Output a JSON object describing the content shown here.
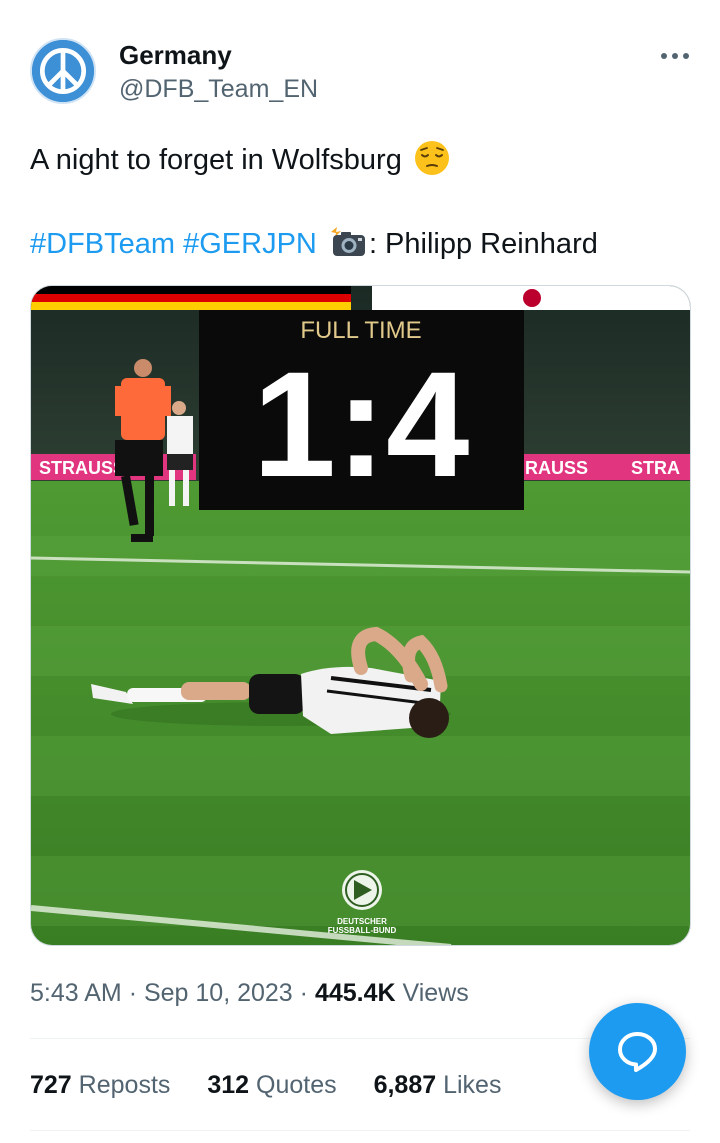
{
  "account": {
    "display_name": "Germany",
    "handle": "@DFB_Team_EN",
    "avatar_icon": "peace-sign-icon"
  },
  "tweet": {
    "text": "A night to forget in Wolfsburg",
    "text_emoji": "pensive-face-emoji",
    "hashtags": [
      "#DFBTeam",
      "#GERJPN"
    ],
    "camera_emoji": "camera-with-flash-emoji",
    "photo_credit": ": Philipp Reinhard"
  },
  "media": {
    "label": "FULL TIME",
    "score": "1:4",
    "banner_text_left": "STRAUSS",
    "banner_text_right": "RAUSS",
    "banner_text_right2": "STRA",
    "logo_text_line1": "DEUTSCHER",
    "logo_text_line2": "FUSSBALL-BUND"
  },
  "meta": {
    "time": "5:43 AM",
    "separator": "·",
    "date": "Sep 10, 2023",
    "views_count": "445.4K",
    "views_label": "Views"
  },
  "stats": {
    "reposts_count": "727",
    "reposts_label": "Reposts",
    "quotes_count": "312",
    "quotes_label": "Quotes",
    "likes_count": "6,887",
    "likes_label": "Likes"
  },
  "colors": {
    "accent": "#1d9bf0",
    "secondary_text": "#536471",
    "flag_black": "#000000",
    "flag_red": "#dd0000",
    "flag_gold": "#ffce00",
    "japan_red": "#bc002d",
    "pitch_green": "#3f8a2a"
  }
}
